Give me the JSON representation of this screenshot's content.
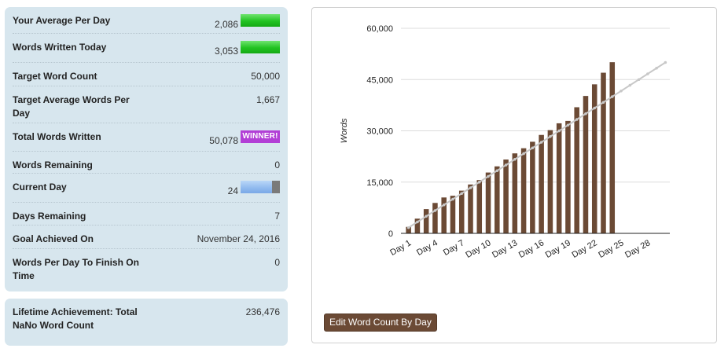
{
  "stats": [
    {
      "label": "Your Average Per Day",
      "value": "2,086",
      "indicator": "bar"
    },
    {
      "label": "Words Written Today",
      "value": "3,053",
      "indicator": "bar"
    },
    {
      "label": "Target Word Count",
      "value": "50,000"
    },
    {
      "label": "Target Average Words Per Day",
      "value": "1,667"
    },
    {
      "label": "Total Words Written",
      "value": "50,078",
      "badge": "WINNER!"
    },
    {
      "label": "Words Remaining",
      "value": "0"
    },
    {
      "label": "Current Day",
      "value": "24",
      "progress": 0.8
    },
    {
      "label": "Days Remaining",
      "value": "7"
    },
    {
      "label": "Goal Achieved On",
      "value": "November 24, 2016"
    },
    {
      "label": "Words Per Day To Finish On Time",
      "value": "0"
    }
  ],
  "lifetime": {
    "label": "Lifetime Achievement: Total NaNo Word Count",
    "value": "236,476"
  },
  "edit_button_label": "Edit Word Count By Day",
  "colors": {
    "panel": "#d7e6ee",
    "bar": "#6b4a35",
    "target_line": "#c8c8c8",
    "winner": "#b23fd6"
  },
  "chart_data": {
    "type": "bar",
    "ylabel": "Words",
    "xlabel": "",
    "ylim": [
      0,
      60000
    ],
    "yticks": [
      0,
      15000,
      30000,
      45000,
      60000
    ],
    "ytick_labels": [
      "0",
      "15,000",
      "30,000",
      "45,000",
      "60,000"
    ],
    "xtick_labels": [
      "Day 1",
      "Day 4",
      "Day 7",
      "Day 10",
      "Day 13",
      "Day 16",
      "Day 19",
      "Day 22",
      "Day 25",
      "Day 28"
    ],
    "days_shown": 30,
    "categories": [
      1,
      2,
      3,
      4,
      5,
      6,
      7,
      8,
      9,
      10,
      11,
      12,
      13,
      14,
      15,
      16,
      17,
      18,
      19,
      20,
      21,
      22,
      23,
      24
    ],
    "series": [
      {
        "type": "bar",
        "values": [
          1900,
          4300,
          7100,
          8900,
          10500,
          11000,
          12500,
          14300,
          15600,
          17800,
          19600,
          21600,
          23400,
          24900,
          26800,
          28800,
          30200,
          32200,
          32900,
          36900,
          40200,
          43600,
          47000,
          50078
        ]
      },
      {
        "type": "line",
        "x": [
          1,
          30
        ],
        "values": [
          1667,
          50000
        ]
      }
    ]
  }
}
